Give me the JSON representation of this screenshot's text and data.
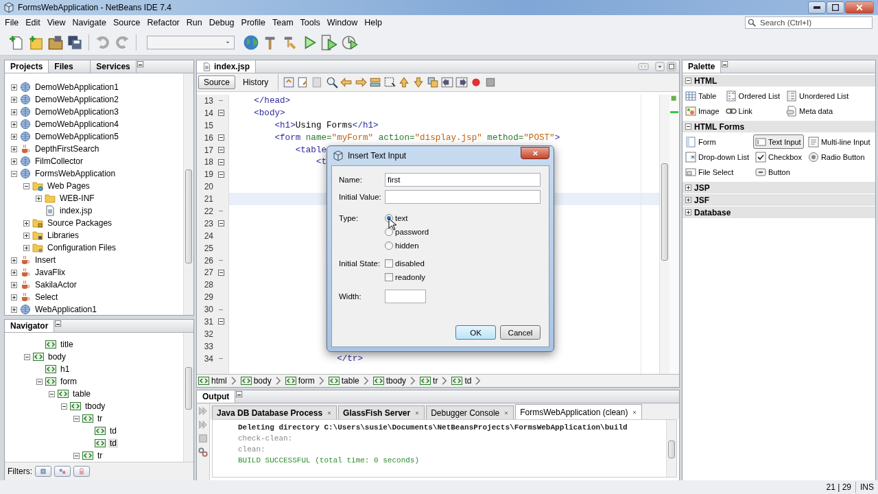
{
  "window": {
    "title": "FormsWebApplication - NetBeans IDE 7.4"
  },
  "menu": [
    "File",
    "Edit",
    "View",
    "Navigate",
    "Source",
    "Refactor",
    "Run",
    "Debug",
    "Profile",
    "Team",
    "Tools",
    "Window",
    "Help"
  ],
  "search": {
    "placeholder": "Search (Ctrl+I)"
  },
  "projects_panel": {
    "tabs": [
      {
        "label": "Projects",
        "selected": true
      },
      {
        "label": "Files",
        "selected": false
      },
      {
        "label": "Services",
        "selected": false
      }
    ],
    "tree": [
      {
        "label": "DemoWebApplication1",
        "kind": "web",
        "expanded": false
      },
      {
        "label": "DemoWebApplication2",
        "kind": "web",
        "expanded": false
      },
      {
        "label": "DemoWebApplication3",
        "kind": "web",
        "expanded": false
      },
      {
        "label": "DemoWebApplication4",
        "kind": "web",
        "expanded": false
      },
      {
        "label": "DemoWebApplication5",
        "kind": "web",
        "expanded": false
      },
      {
        "label": "DepthFirstSearch",
        "kind": "java",
        "expanded": false
      },
      {
        "label": "FilmCollector",
        "kind": "web",
        "expanded": false
      },
      {
        "label": "FormsWebApplication",
        "kind": "web",
        "expanded": true,
        "children": [
          {
            "label": "Web Pages",
            "kind": "webfolder",
            "expanded": true,
            "children": [
              {
                "label": "WEB-INF",
                "kind": "folder",
                "expanded": false
              },
              {
                "label": "index.jsp",
                "kind": "file"
              }
            ]
          },
          {
            "label": "Source Packages",
            "kind": "sources",
            "expanded": false
          },
          {
            "label": "Libraries",
            "kind": "libraries",
            "expanded": false
          },
          {
            "label": "Configuration Files",
            "kind": "config",
            "expanded": false
          }
        ]
      },
      {
        "label": "Insert",
        "kind": "java",
        "expanded": false
      },
      {
        "label": "JavaFlix",
        "kind": "java",
        "expanded": false
      },
      {
        "label": "SakilaActor",
        "kind": "java",
        "expanded": false
      },
      {
        "label": "Select",
        "kind": "java",
        "expanded": false
      },
      {
        "label": "WebApplication1",
        "kind": "web",
        "expanded": false
      }
    ]
  },
  "navigator": {
    "title": "Navigator",
    "tree": [
      {
        "children": [
          {
            "label": "title",
            "selected": false
          }
        ]
      },
      {
        "label": "body",
        "expanded": true,
        "selected": false,
        "children": [
          {
            "label": "h1",
            "selected": false
          },
          {
            "label": "form",
            "expanded": true,
            "selected": false,
            "children": [
              {
                "label": "table",
                "expanded": true,
                "selected": false,
                "children": [
                  {
                    "label": "tbody",
                    "expanded": true,
                    "selected": false,
                    "children": [
                      {
                        "label": "tr",
                        "expanded": true,
                        "selected": false,
                        "children": [
                          {
                            "label": "td",
                            "selected": false
                          },
                          {
                            "label": "td",
                            "selected": true
                          }
                        ]
                      },
                      {
                        "label": "tr",
                        "expanded": true,
                        "selected": false
                      }
                    ]
                  }
                ]
              }
            ]
          }
        ]
      }
    ],
    "filters_label": "Filters:"
  },
  "editor": {
    "tab": "index.jsp",
    "views": [
      {
        "label": "Source",
        "selected": true
      },
      {
        "label": "History",
        "selected": false
      }
    ],
    "lines": [
      {
        "number": "13",
        "kind": "closing",
        "current": false,
        "segments": [
          {
            "kind": "tag",
            "text": "    </head>"
          }
        ]
      },
      {
        "number": "14",
        "kind": "opening",
        "current": false,
        "segments": [
          {
            "kind": "tag",
            "text": "    <body>"
          }
        ]
      },
      {
        "number": "15",
        "kind": "plain",
        "current": false,
        "segments": [
          {
            "kind": "tag",
            "text": "        <h1>"
          },
          {
            "kind": "text",
            "text": "Using Forms"
          },
          {
            "kind": "tag",
            "text": "</h1>"
          }
        ]
      },
      {
        "number": "16",
        "kind": "opening",
        "current": false,
        "segments": [
          {
            "kind": "tag",
            "text": "        <form"
          },
          {
            "kind": "attr",
            "text": " name="
          },
          {
            "kind": "value",
            "text": "\"myForm\""
          },
          {
            "kind": "attr",
            "text": " action="
          },
          {
            "kind": "value",
            "text": "\"display.jsp\""
          },
          {
            "kind": "attr",
            "text": " method="
          },
          {
            "kind": "value",
            "text": "\"POST\""
          },
          {
            "kind": "tag",
            "text": ">"
          }
        ]
      },
      {
        "number": "17",
        "kind": "opening",
        "current": false,
        "segments": [
          {
            "kind": "tag",
            "text": "            <table"
          }
        ]
      },
      {
        "number": "18",
        "kind": "opening",
        "current": false,
        "segments": [
          {
            "kind": "tag",
            "text": "                <t"
          }
        ]
      },
      {
        "number": "19",
        "kind": "opening",
        "current": false
      },
      {
        "number": "20",
        "kind": "plain",
        "current": false
      },
      {
        "number": "21",
        "kind": "plain",
        "current": true
      },
      {
        "number": "22",
        "kind": "closing",
        "current": false
      },
      {
        "number": "23",
        "kind": "opening",
        "current": false
      },
      {
        "number": "24",
        "kind": "plain",
        "current": false
      },
      {
        "number": "25",
        "kind": "plain",
        "current": false
      },
      {
        "number": "26",
        "kind": "closing",
        "current": false
      },
      {
        "number": "27",
        "kind": "opening",
        "current": false
      },
      {
        "number": "28",
        "kind": "plain",
        "current": false
      },
      {
        "number": "29",
        "kind": "plain",
        "current": false
      },
      {
        "number": "30",
        "kind": "closing",
        "current": false
      },
      {
        "number": "31",
        "kind": "opening",
        "current": false
      },
      {
        "number": "32",
        "kind": "plain",
        "current": false
      },
      {
        "number": "33",
        "kind": "plain",
        "current": false
      },
      {
        "number": "34",
        "kind": "closing",
        "current": false,
        "segments": [
          {
            "kind": "tag",
            "text": "                    </tr>"
          }
        ]
      }
    ],
    "breadcrumbs": [
      "html",
      "body",
      "form",
      "table",
      "tbody",
      "tr",
      "td"
    ]
  },
  "dialog": {
    "title": "Insert Text Input",
    "fields": [
      {
        "label": "Name:",
        "value": "first"
      },
      {
        "label": "Initial Value:"
      }
    ],
    "type": {
      "label": "Type:",
      "options": [
        {
          "label": "text",
          "selected": true
        },
        {
          "label": "password",
          "selected": false
        },
        {
          "label": "hidden",
          "selected": false
        }
      ]
    },
    "initial_state": {
      "label": "Initial State:",
      "options": [
        {
          "label": "disabled",
          "checked": false
        },
        {
          "label": "readonly",
          "checked": false
        }
      ]
    },
    "width": {
      "label": "Width:"
    },
    "buttons": [
      {
        "label": "OK",
        "default": true
      },
      {
        "label": "Cancel",
        "default": false
      }
    ]
  },
  "palette": {
    "title": "Palette",
    "sections": [
      {
        "label": "HTML",
        "expanded": true,
        "items": [
          {
            "label": "Table",
            "kind": "table",
            "selected": false
          },
          {
            "label": "Ordered List",
            "kind": "ordered",
            "selected": false
          },
          {
            "label": "Unordered List",
            "kind": "unordered",
            "selected": false
          },
          {
            "label": "Image",
            "kind": "image",
            "selected": false
          },
          {
            "label": "Link",
            "kind": "link",
            "selected": false
          },
          {
            "label": "Meta data",
            "kind": "meta",
            "selected": false
          }
        ]
      },
      {
        "label": "HTML Forms",
        "expanded": true,
        "items": [
          {
            "label": "Form",
            "kind": "form",
            "selected": false
          },
          {
            "label": "Text Input",
            "kind": "input",
            "selected": true
          },
          {
            "label": "Multi-line Input",
            "kind": "textarea",
            "selected": false
          },
          {
            "label": "Drop-down List",
            "kind": "dropdown",
            "selected": false
          },
          {
            "label": "Checkbox",
            "kind": "checkbox",
            "selected": false
          },
          {
            "label": "Radio Button",
            "kind": "radio",
            "selected": false
          },
          {
            "label": "File Select",
            "kind": "fileselect",
            "selected": false
          },
          {
            "label": "Button",
            "kind": "button",
            "selected": false
          }
        ]
      },
      {
        "label": "JSP",
        "expanded": false
      },
      {
        "label": "JSF",
        "expanded": false
      },
      {
        "label": "Database",
        "expanded": false
      }
    ]
  },
  "output": {
    "title": "Output",
    "tabs": [
      {
        "label": "Java DB Database Process",
        "selected": false,
        "bold": true
      },
      {
        "label": "GlassFish Server",
        "selected": false,
        "bold": true
      },
      {
        "label": "Debugger Console",
        "selected": false,
        "bold": false
      },
      {
        "label": "FormsWebApplication (clean)",
        "selected": true,
        "bold": false
      }
    ],
    "lines": [
      {
        "kind": "normal",
        "text": "Deleting directory C:\\Users\\susie\\Documents\\NetBeansProjects\\FormsWebApplication\\build"
      },
      {
        "kind": "muted",
        "text": "check-clean:"
      },
      {
        "kind": "muted",
        "text": "clean:"
      },
      {
        "kind": "success",
        "text": "BUILD SUCCESSFUL (total time: 0 seconds)"
      }
    ]
  },
  "status_bar": {
    "position": "21 | 29",
    "mode": "INS"
  }
}
